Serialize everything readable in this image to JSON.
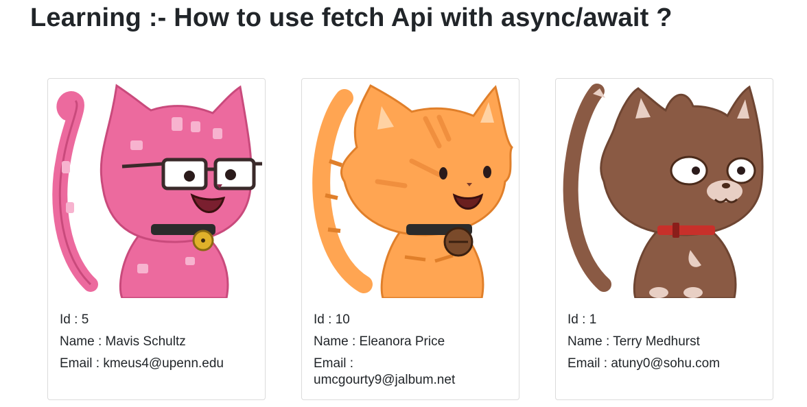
{
  "header": {
    "title": "Learning :- How to use fetch Api with async/await ?"
  },
  "labels": {
    "id": "Id : ",
    "name": "Name : ",
    "email": "Email : "
  },
  "cards": [
    {
      "id": "5",
      "name": "Mavis Schultz",
      "email": "kmeus4@upenn.edu",
      "image_icon": "pink-cat-with-glasses-avatar",
      "colors": {
        "fur": "#ec6a9e",
        "fur_dark": "#c94a7c",
        "spots": "#f7b3cf",
        "collar": "#2b2b2b",
        "bell": "#e0b12a"
      }
    },
    {
      "id": "10",
      "name": "Eleanora Price",
      "email": "umcgourty9@jalbum.net",
      "image_icon": "orange-tabby-cat-avatar",
      "colors": {
        "fur": "#ffa552",
        "fur_dark": "#e07f2a",
        "spots": "#f08f3e",
        "collar": "#2b2b2b",
        "bell": "#7a4a2a"
      }
    },
    {
      "id": "1",
      "name": "Terry Medhurst",
      "email": "atuny0@sohu.com",
      "image_icon": "brown-cat-avatar",
      "colors": {
        "fur": "#8a5a44",
        "fur_dark": "#6e4532",
        "spots": "#e8cfc4",
        "collar": "#c8302a",
        "bell": "#8a1e1a"
      }
    }
  ]
}
